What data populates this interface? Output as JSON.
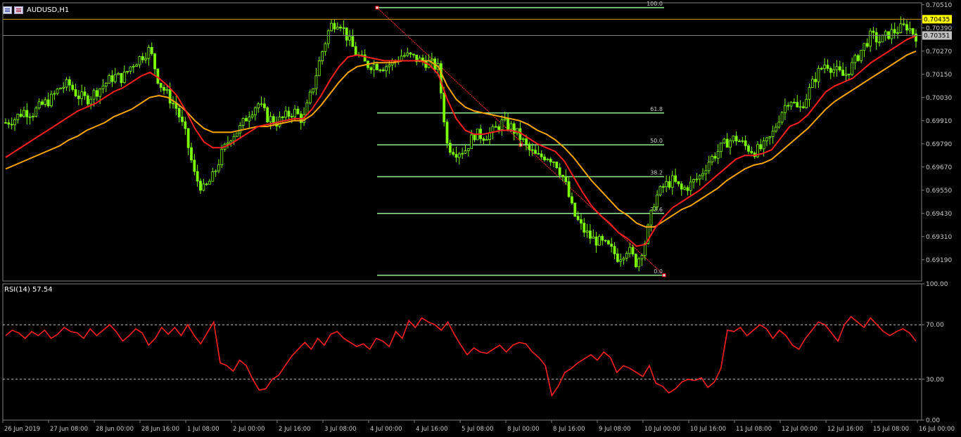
{
  "window": {
    "symbol_label": "AUDUSD,H1",
    "rsi_label": "RSI(14) 57.54",
    "icons": [
      "chart-table-icon",
      "chart-flag-icon"
    ]
  },
  "chart_data": [
    {
      "type": "candlestick",
      "title": "AUDUSD,H1",
      "ylim": [
        0.6908,
        0.7052
      ],
      "y_ticks": [
        "0.70510",
        "0.70390",
        "0.70270",
        "0.70150",
        "0.70030",
        "0.69910",
        "0.69790",
        "0.69670",
        "0.69550",
        "0.69430",
        "0.69310",
        "0.69190"
      ],
      "x_ticks": [
        "26 Jun 2019",
        "27 Jun 08:00",
        "28 Jun 00:00",
        "28 Jun 16:00",
        "1 Jul 08:00",
        "2 Jul 00:00",
        "2 Jul 16:00",
        "3 Jul 08:00",
        "4 Jul 00:00",
        "4 Jul 16:00",
        "5 Jul 08:00",
        "8 Jul 00:00",
        "8 Jul 16:00",
        "9 Jul 08:00",
        "10 Jul 00:00",
        "10 Jul 16:00",
        "11 Jul 08:00",
        "12 Jul 00:00",
        "12 Jul 16:00",
        "15 Jul 08:00",
        "16 Jul 00:00"
      ],
      "price_markers": [
        {
          "label": "0.70435",
          "value": 0.70435,
          "color": "#ffff00"
        },
        {
          "label": "0.70351",
          "value": 0.70351,
          "color": "#c0c0c0"
        }
      ],
      "close_path": [
        0.699,
        0.6992,
        0.6996,
        0.6995,
        0.6999,
        0.7002,
        0.7008,
        0.701,
        0.7004,
        0.7002,
        0.7006,
        0.701,
        0.7014,
        0.7013,
        0.702,
        0.7024,
        0.7028,
        0.7011,
        0.7004,
        0.6997,
        0.6983,
        0.6962,
        0.6955,
        0.6962,
        0.6974,
        0.6983,
        0.6987,
        0.6995,
        0.7,
        0.6993,
        0.699,
        0.6993,
        0.6996,
        0.6991,
        0.7007,
        0.7025,
        0.704,
        0.7043,
        0.7033,
        0.7025,
        0.702,
        0.702,
        0.7019,
        0.7021,
        0.7025,
        0.7024,
        0.7022,
        0.7021,
        0.7018,
        0.6978,
        0.6975,
        0.6976,
        0.6984,
        0.6983,
        0.6985,
        0.699,
        0.6988,
        0.6983,
        0.6976,
        0.6972,
        0.6973,
        0.697,
        0.696,
        0.6943,
        0.6935,
        0.693,
        0.6928,
        0.6925,
        0.692,
        0.6925,
        0.6917,
        0.6929,
        0.695,
        0.6957,
        0.696,
        0.6955,
        0.6958,
        0.6962,
        0.697,
        0.6975,
        0.698,
        0.6982,
        0.6978,
        0.6975,
        0.6977,
        0.6983,
        0.6995,
        0.7003,
        0.6996,
        0.7005,
        0.7015,
        0.7021,
        0.7017,
        0.7014,
        0.702,
        0.7028,
        0.7035,
        0.7032,
        0.7036,
        0.7038,
        0.704,
        0.7035
      ],
      "ma_red": [
        0.6972,
        0.6975,
        0.6978,
        0.6981,
        0.6984,
        0.6987,
        0.699,
        0.6993,
        0.6996,
        0.6998,
        0.7,
        0.7003,
        0.7006,
        0.7008,
        0.7011,
        0.7014,
        0.7016,
        0.7013,
        0.7009,
        0.7004,
        0.6996,
        0.6987,
        0.698,
        0.6977,
        0.6977,
        0.6979,
        0.6982,
        0.6985,
        0.6988,
        0.6989,
        0.699,
        0.6991,
        0.6992,
        0.6992,
        0.6997,
        0.7004,
        0.7012,
        0.7019,
        0.7024,
        0.7025,
        0.7024,
        0.7023,
        0.7022,
        0.7022,
        0.7022,
        0.7022,
        0.7022,
        0.702,
        0.7015,
        0.7002,
        0.6992,
        0.6986,
        0.6984,
        0.6984,
        0.6985,
        0.6986,
        0.6986,
        0.6985,
        0.6982,
        0.6979,
        0.6977,
        0.6975,
        0.697,
        0.6962,
        0.6954,
        0.6947,
        0.6942,
        0.6938,
        0.6933,
        0.693,
        0.6926,
        0.6927,
        0.6935,
        0.6941,
        0.6946,
        0.6949,
        0.6952,
        0.6955,
        0.6959,
        0.6963,
        0.6967,
        0.6971,
        0.6973,
        0.6973,
        0.6974,
        0.6976,
        0.6982,
        0.6988,
        0.699,
        0.6994,
        0.7,
        0.7006,
        0.7009,
        0.7011,
        0.7013,
        0.7017,
        0.7021,
        0.7024,
        0.7027,
        0.703,
        0.7033,
        0.7035
      ],
      "ma_orange": [
        0.6966,
        0.6968,
        0.697,
        0.6972,
        0.6974,
        0.6976,
        0.6978,
        0.6981,
        0.6983,
        0.6986,
        0.6988,
        0.699,
        0.6993,
        0.6995,
        0.6997,
        0.7,
        0.7003,
        0.7004,
        0.7003,
        0.7,
        0.6996,
        0.6991,
        0.6987,
        0.6985,
        0.6985,
        0.6985,
        0.6986,
        0.6987,
        0.6988,
        0.6988,
        0.6989,
        0.699,
        0.6991,
        0.6991,
        0.6994,
        0.6999,
        0.7005,
        0.7011,
        0.7016,
        0.7019,
        0.702,
        0.7021,
        0.7021,
        0.7021,
        0.7022,
        0.7022,
        0.7022,
        0.7022,
        0.7019,
        0.7009,
        0.7002,
        0.6998,
        0.6996,
        0.6995,
        0.6994,
        0.6993,
        0.6992,
        0.6991,
        0.6989,
        0.6986,
        0.6984,
        0.6981,
        0.6977,
        0.6972,
        0.6966,
        0.696,
        0.6955,
        0.695,
        0.6945,
        0.6942,
        0.6938,
        0.6936,
        0.6936,
        0.6939,
        0.6942,
        0.6945,
        0.6947,
        0.695,
        0.6953,
        0.6956,
        0.696,
        0.6963,
        0.6966,
        0.6968,
        0.6969,
        0.6971,
        0.6975,
        0.6979,
        0.6983,
        0.6987,
        0.6992,
        0.6997,
        0.7001,
        0.7004,
        0.7007,
        0.701,
        0.7013,
        0.7016,
        0.7019,
        0.7022,
        0.7025,
        0.7027
      ],
      "fibonacci": {
        "levels": [
          {
            "label": "100.0",
            "value": 0.70495
          },
          {
            "label": "61.8",
            "value": 0.6995
          },
          {
            "label": "50.0",
            "value": 0.69785
          },
          {
            "label": "38.2",
            "value": 0.6962
          },
          {
            "label": "23.6",
            "value": 0.6943
          },
          {
            "label": "0.0",
            "value": 0.6911
          }
        ],
        "color": "#90ee90",
        "trend_color": "#ff3030"
      }
    },
    {
      "type": "line",
      "title": "RSI(14) 57.54",
      "ylim": [
        0,
        100
      ],
      "y_ticks": [
        "100.00",
        "70.00",
        "30.00",
        "0.00"
      ],
      "levels": [
        70,
        30
      ],
      "color": "#ff2020",
      "values": [
        62,
        66,
        64,
        60,
        65,
        62,
        66,
        60,
        63,
        68,
        65,
        64,
        60,
        67,
        62,
        66,
        70,
        65,
        58,
        62,
        67,
        64,
        55,
        60,
        68,
        63,
        68,
        62,
        70,
        62,
        56,
        64,
        72,
        42,
        40,
        36,
        44,
        40,
        30,
        22,
        23,
        30,
        33,
        40,
        47,
        52,
        57,
        52,
        60,
        55,
        63,
        65,
        60,
        57,
        54,
        56,
        52,
        60,
        58,
        54,
        65,
        60,
        73,
        68,
        75,
        72,
        70,
        66,
        72,
        63,
        55,
        48,
        53,
        50,
        49,
        52,
        55,
        50,
        55,
        57,
        56,
        50,
        46,
        40,
        18,
        25,
        35,
        38,
        42,
        45,
        48,
        44,
        50,
        46,
        35,
        40,
        38,
        35,
        32,
        40,
        27,
        25,
        20,
        23,
        28,
        30,
        29,
        31,
        24,
        28,
        38,
        66,
        65,
        68,
        62,
        66,
        70,
        67,
        60,
        66,
        62,
        55,
        52,
        60,
        66,
        72,
        70,
        64,
        58,
        70,
        76,
        72,
        68,
        75,
        70,
        65,
        62,
        65,
        67,
        64,
        58
      ]
    }
  ]
}
